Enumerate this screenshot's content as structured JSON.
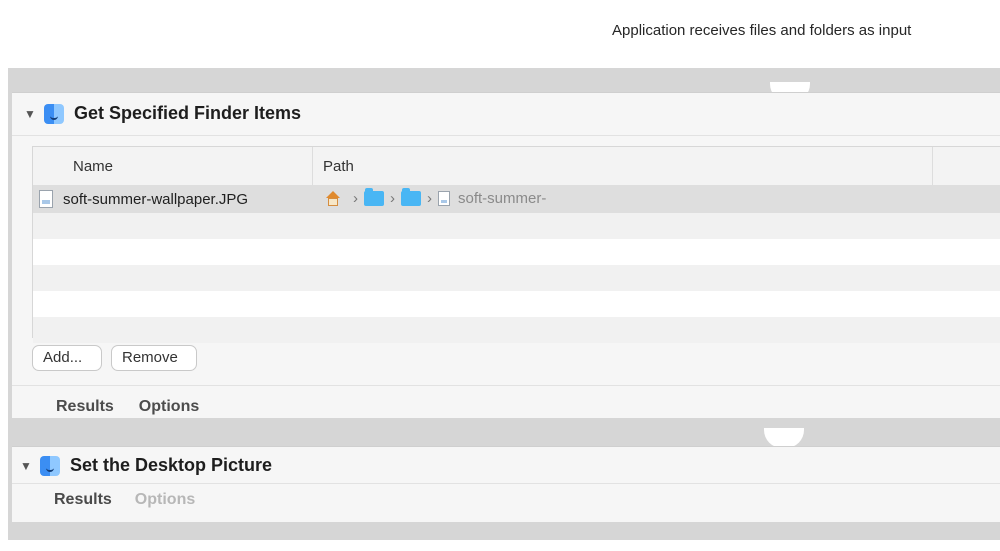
{
  "header_note": "Application receives files and folders as input",
  "actions": [
    {
      "title": "Get Specified Finder Items",
      "columns": [
        "Name",
        "Path"
      ],
      "rows": [
        {
          "name": "soft-summer-wallpaper.JPG",
          "path_tail": "soft-summer-"
        }
      ],
      "buttons": [
        "Add...",
        "Remove"
      ],
      "tabs": [
        "Results",
        "Options"
      ]
    },
    {
      "title": "Set the Desktop Picture",
      "tabs": [
        "Results",
        "Options"
      ]
    }
  ],
  "icons": {
    "disclosure": "disclosure-triangle-icon",
    "finder": "finder-icon",
    "file": "document-icon",
    "home": "home-icon",
    "folder": "folder-icon"
  }
}
